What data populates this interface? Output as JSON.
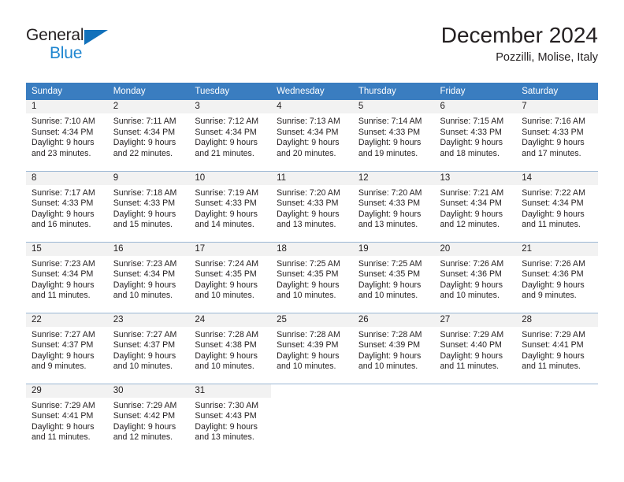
{
  "brand": {
    "name_part1": "General",
    "name_part2": "Blue",
    "triangle_color": "#1271bb",
    "blue_text_color": "#1f86d0"
  },
  "header": {
    "title": "December 2024",
    "subtitle": "Pozzilli, Molise, Italy"
  },
  "theme": {
    "header_row_bg": "#3a7dc0",
    "daynum_band_bg": "#f2f2f2",
    "row_divider": "#9bb7d4",
    "text": "#231f20"
  },
  "columns": [
    "Sunday",
    "Monday",
    "Tuesday",
    "Wednesday",
    "Thursday",
    "Friday",
    "Saturday"
  ],
  "labels": {
    "sunrise_prefix": "Sunrise:",
    "sunset_prefix": "Sunset:",
    "daylight_prefix": "Daylight:"
  },
  "weeks": [
    [
      {
        "day": "1",
        "sunrise": "Sunrise: 7:10 AM",
        "sunset": "Sunset: 4:34 PM",
        "daylight1": "Daylight: 9 hours",
        "daylight2": "and 23 minutes."
      },
      {
        "day": "2",
        "sunrise": "Sunrise: 7:11 AM",
        "sunset": "Sunset: 4:34 PM",
        "daylight1": "Daylight: 9 hours",
        "daylight2": "and 22 minutes."
      },
      {
        "day": "3",
        "sunrise": "Sunrise: 7:12 AM",
        "sunset": "Sunset: 4:34 PM",
        "daylight1": "Daylight: 9 hours",
        "daylight2": "and 21 minutes."
      },
      {
        "day": "4",
        "sunrise": "Sunrise: 7:13 AM",
        "sunset": "Sunset: 4:34 PM",
        "daylight1": "Daylight: 9 hours",
        "daylight2": "and 20 minutes."
      },
      {
        "day": "5",
        "sunrise": "Sunrise: 7:14 AM",
        "sunset": "Sunset: 4:33 PM",
        "daylight1": "Daylight: 9 hours",
        "daylight2": "and 19 minutes."
      },
      {
        "day": "6",
        "sunrise": "Sunrise: 7:15 AM",
        "sunset": "Sunset: 4:33 PM",
        "daylight1": "Daylight: 9 hours",
        "daylight2": "and 18 minutes."
      },
      {
        "day": "7",
        "sunrise": "Sunrise: 7:16 AM",
        "sunset": "Sunset: 4:33 PM",
        "daylight1": "Daylight: 9 hours",
        "daylight2": "and 17 minutes."
      }
    ],
    [
      {
        "day": "8",
        "sunrise": "Sunrise: 7:17 AM",
        "sunset": "Sunset: 4:33 PM",
        "daylight1": "Daylight: 9 hours",
        "daylight2": "and 16 minutes."
      },
      {
        "day": "9",
        "sunrise": "Sunrise: 7:18 AM",
        "sunset": "Sunset: 4:33 PM",
        "daylight1": "Daylight: 9 hours",
        "daylight2": "and 15 minutes."
      },
      {
        "day": "10",
        "sunrise": "Sunrise: 7:19 AM",
        "sunset": "Sunset: 4:33 PM",
        "daylight1": "Daylight: 9 hours",
        "daylight2": "and 14 minutes."
      },
      {
        "day": "11",
        "sunrise": "Sunrise: 7:20 AM",
        "sunset": "Sunset: 4:33 PM",
        "daylight1": "Daylight: 9 hours",
        "daylight2": "and 13 minutes."
      },
      {
        "day": "12",
        "sunrise": "Sunrise: 7:20 AM",
        "sunset": "Sunset: 4:33 PM",
        "daylight1": "Daylight: 9 hours",
        "daylight2": "and 13 minutes."
      },
      {
        "day": "13",
        "sunrise": "Sunrise: 7:21 AM",
        "sunset": "Sunset: 4:34 PM",
        "daylight1": "Daylight: 9 hours",
        "daylight2": "and 12 minutes."
      },
      {
        "day": "14",
        "sunrise": "Sunrise: 7:22 AM",
        "sunset": "Sunset: 4:34 PM",
        "daylight1": "Daylight: 9 hours",
        "daylight2": "and 11 minutes."
      }
    ],
    [
      {
        "day": "15",
        "sunrise": "Sunrise: 7:23 AM",
        "sunset": "Sunset: 4:34 PM",
        "daylight1": "Daylight: 9 hours",
        "daylight2": "and 11 minutes."
      },
      {
        "day": "16",
        "sunrise": "Sunrise: 7:23 AM",
        "sunset": "Sunset: 4:34 PM",
        "daylight1": "Daylight: 9 hours",
        "daylight2": "and 10 minutes."
      },
      {
        "day": "17",
        "sunrise": "Sunrise: 7:24 AM",
        "sunset": "Sunset: 4:35 PM",
        "daylight1": "Daylight: 9 hours",
        "daylight2": "and 10 minutes."
      },
      {
        "day": "18",
        "sunrise": "Sunrise: 7:25 AM",
        "sunset": "Sunset: 4:35 PM",
        "daylight1": "Daylight: 9 hours",
        "daylight2": "and 10 minutes."
      },
      {
        "day": "19",
        "sunrise": "Sunrise: 7:25 AM",
        "sunset": "Sunset: 4:35 PM",
        "daylight1": "Daylight: 9 hours",
        "daylight2": "and 10 minutes."
      },
      {
        "day": "20",
        "sunrise": "Sunrise: 7:26 AM",
        "sunset": "Sunset: 4:36 PM",
        "daylight1": "Daylight: 9 hours",
        "daylight2": "and 10 minutes."
      },
      {
        "day": "21",
        "sunrise": "Sunrise: 7:26 AM",
        "sunset": "Sunset: 4:36 PM",
        "daylight1": "Daylight: 9 hours",
        "daylight2": "and 9 minutes."
      }
    ],
    [
      {
        "day": "22",
        "sunrise": "Sunrise: 7:27 AM",
        "sunset": "Sunset: 4:37 PM",
        "daylight1": "Daylight: 9 hours",
        "daylight2": "and 9 minutes."
      },
      {
        "day": "23",
        "sunrise": "Sunrise: 7:27 AM",
        "sunset": "Sunset: 4:37 PM",
        "daylight1": "Daylight: 9 hours",
        "daylight2": "and 10 minutes."
      },
      {
        "day": "24",
        "sunrise": "Sunrise: 7:28 AM",
        "sunset": "Sunset: 4:38 PM",
        "daylight1": "Daylight: 9 hours",
        "daylight2": "and 10 minutes."
      },
      {
        "day": "25",
        "sunrise": "Sunrise: 7:28 AM",
        "sunset": "Sunset: 4:39 PM",
        "daylight1": "Daylight: 9 hours",
        "daylight2": "and 10 minutes."
      },
      {
        "day": "26",
        "sunrise": "Sunrise: 7:28 AM",
        "sunset": "Sunset: 4:39 PM",
        "daylight1": "Daylight: 9 hours",
        "daylight2": "and 10 minutes."
      },
      {
        "day": "27",
        "sunrise": "Sunrise: 7:29 AM",
        "sunset": "Sunset: 4:40 PM",
        "daylight1": "Daylight: 9 hours",
        "daylight2": "and 11 minutes."
      },
      {
        "day": "28",
        "sunrise": "Sunrise: 7:29 AM",
        "sunset": "Sunset: 4:41 PM",
        "daylight1": "Daylight: 9 hours",
        "daylight2": "and 11 minutes."
      }
    ],
    [
      {
        "day": "29",
        "sunrise": "Sunrise: 7:29 AM",
        "sunset": "Sunset: 4:41 PM",
        "daylight1": "Daylight: 9 hours",
        "daylight2": "and 11 minutes."
      },
      {
        "day": "30",
        "sunrise": "Sunrise: 7:29 AM",
        "sunset": "Sunset: 4:42 PM",
        "daylight1": "Daylight: 9 hours",
        "daylight2": "and 12 minutes."
      },
      {
        "day": "31",
        "sunrise": "Sunrise: 7:30 AM",
        "sunset": "Sunset: 4:43 PM",
        "daylight1": "Daylight: 9 hours",
        "daylight2": "and 13 minutes."
      },
      {
        "day": "",
        "sunrise": "",
        "sunset": "",
        "daylight1": "",
        "daylight2": ""
      },
      {
        "day": "",
        "sunrise": "",
        "sunset": "",
        "daylight1": "",
        "daylight2": ""
      },
      {
        "day": "",
        "sunrise": "",
        "sunset": "",
        "daylight1": "",
        "daylight2": ""
      },
      {
        "day": "",
        "sunrise": "",
        "sunset": "",
        "daylight1": "",
        "daylight2": ""
      }
    ]
  ]
}
